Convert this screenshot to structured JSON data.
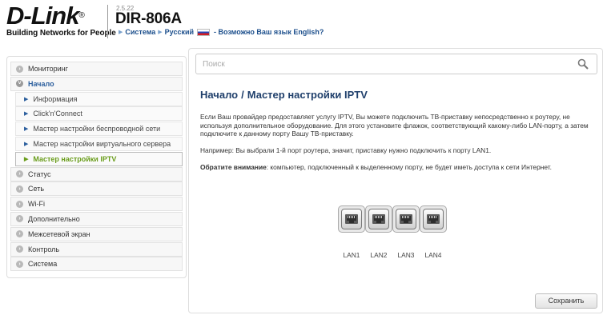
{
  "header": {
    "logo_text": "D-Link",
    "logo_reg": "®",
    "logo_tagline": "Building Networks for People",
    "version": "2.5.22",
    "model": "DIR-806A",
    "breadcrumb": {
      "item1": "Система",
      "item2": "Русский",
      "lang_hint": "- Возможно Ваш язык English?"
    }
  },
  "sidebar": {
    "items": [
      {
        "label": "Мониторинг",
        "icon": "expand-icon"
      },
      {
        "label": "Начало",
        "icon": "collapse-icon"
      },
      {
        "label": "Статус",
        "icon": "expand-icon"
      },
      {
        "label": "Сеть",
        "icon": "expand-icon"
      },
      {
        "label": "Wi-Fi",
        "icon": "expand-icon"
      },
      {
        "label": "Дополнительно",
        "icon": "expand-icon"
      },
      {
        "label": "Межсетевой экран",
        "icon": "expand-icon"
      },
      {
        "label": "Контроль",
        "icon": "expand-icon"
      },
      {
        "label": "Система",
        "icon": "expand-icon"
      }
    ],
    "subitems": [
      {
        "label": "Информация"
      },
      {
        "label": "Click'n'Connect"
      },
      {
        "label": "Мастер настройки беспроводной сети"
      },
      {
        "label": "Мастер настройки виртуального сервера"
      },
      {
        "label": "Мастер настройки IPTV"
      }
    ]
  },
  "main": {
    "search_placeholder": "Поиск",
    "title_part1": "Начало",
    "title_sep": "/",
    "title_part2": "Мастер настройки IPTV",
    "paragraph1": "Если Ваш провайдер предоставляет услугу IPTV, Вы можете подключить ТВ-приставку непосредственно к роутеру, не используя дополнительное оборудование. Для этого установите флажок, соответствующий какому-либо LAN-порту, а затем подключите к данному порту Вашу ТВ-приставку.",
    "paragraph2": "Например: Вы выбрали 1-й порт роутера, значит, приставку нужно подключить к порту LAN1.",
    "note_bold": "Обратите внимание",
    "note_text": ": компьютер, подключенный к выделенному порту, не будет иметь доступа к сети Интернет.",
    "ports": [
      "LAN1",
      "LAN2",
      "LAN3",
      "LAN4"
    ],
    "save_label": "Сохранить"
  }
}
